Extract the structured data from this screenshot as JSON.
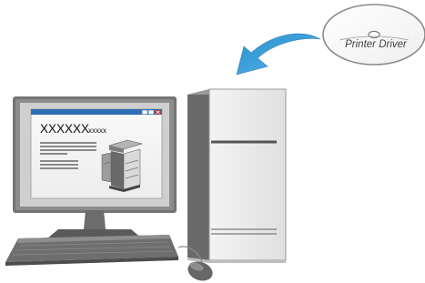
{
  "disc": {
    "label": "Printer Driver",
    "icon": "cd-disc-icon"
  },
  "monitor_screen": {
    "window_heading": "XXXXXX",
    "window_heading_suffix": "xxxxx",
    "window_controls": "□□×",
    "content_icon": "multifunction-printer-icon"
  },
  "arrow": {
    "icon": "curved-arrow-icon",
    "direction": "from disc to computer"
  },
  "colors": {
    "arrow_blue": "#2f96d2",
    "window_titlebar_blue": "#2e6fb4",
    "window_control_red": "#d12a2a",
    "device_gray": "#8f8f8f",
    "device_dark": "#5c5c5c",
    "device_light": "#d7d7d7"
  }
}
